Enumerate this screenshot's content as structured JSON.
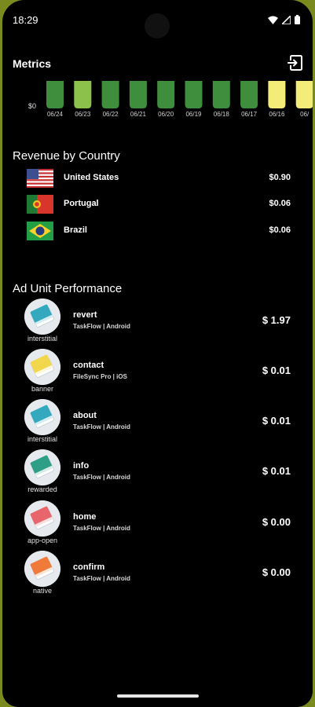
{
  "status": {
    "time": "18:29"
  },
  "app_bar": {
    "title": "Metrics"
  },
  "chart_data": {
    "type": "bar",
    "categories": [
      "06/24",
      "06/23",
      "06/22",
      "06/21",
      "06/20",
      "06/19",
      "06/18",
      "06/17",
      "06/16",
      "06/"
    ],
    "ytick_visible": "$0",
    "colors": [
      "#3e8e3e",
      "#8cc24c",
      "#3e8e3e",
      "#3e8e3e",
      "#3e8e3e",
      "#3e8e3e",
      "#3e8e3e",
      "#3e8e3e",
      "#f4ec78",
      "#f4ec78"
    ]
  },
  "revenue_by_country": {
    "title": "Revenue by Country",
    "rows": [
      {
        "country": "United States",
        "value": "$0.90",
        "flag": "us-flag"
      },
      {
        "country": "Portugal",
        "value": "$0.06",
        "flag": "portugal-flag"
      },
      {
        "country": "Brazil",
        "value": "$0.06",
        "flag": "brazil-flag"
      }
    ]
  },
  "ad_units": {
    "title": "Ad Unit Performance",
    "rows": [
      {
        "name": "revert",
        "app": "TaskFlow | Android",
        "value": "$ 1.97",
        "type": "interstitial",
        "icon": "teal-book-icon",
        "color": "#33a8bf"
      },
      {
        "name": "contact",
        "app": "FileSync Pro | iOS",
        "value": "$ 0.01",
        "type": "banner",
        "icon": "yellow-book-icon",
        "color": "#f2d64b"
      },
      {
        "name": "about",
        "app": "TaskFlow | Android",
        "value": "$ 0.01",
        "type": "interstitial",
        "icon": "teal-book-icon",
        "color": "#33a8bf"
      },
      {
        "name": "info",
        "app": "TaskFlow | Android",
        "value": "$ 0.01",
        "type": "rewarded",
        "icon": "green-book-icon",
        "color": "#2f9e86"
      },
      {
        "name": "home",
        "app": "TaskFlow | Android",
        "value": "$ 0.00",
        "type": "app-open",
        "icon": "red-book-icon",
        "color": "#e8666b"
      },
      {
        "name": "confirm",
        "app": "TaskFlow | Android",
        "value": "$ 0.00",
        "type": "native",
        "icon": "orange-book-icon",
        "color": "#ef7a3a"
      }
    ]
  }
}
